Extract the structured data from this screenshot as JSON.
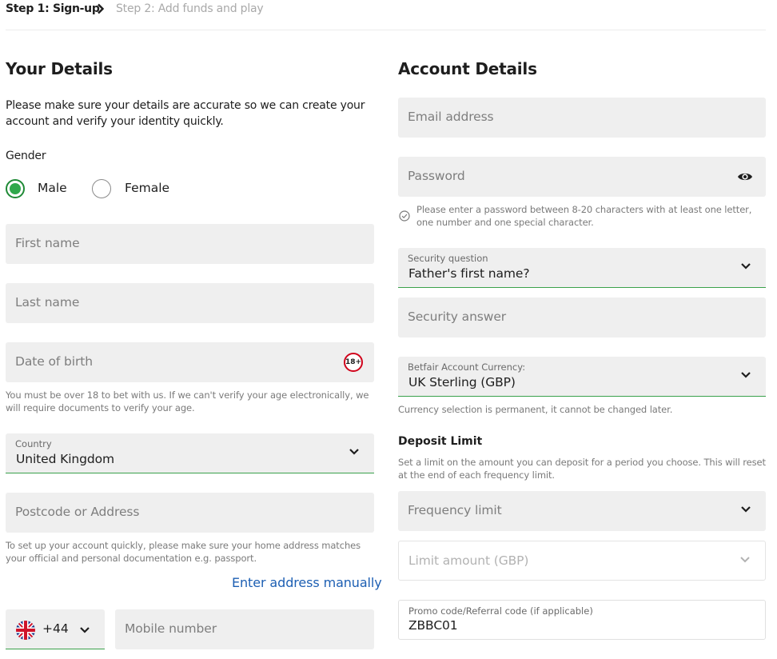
{
  "steps": {
    "step1": "Step 1: Sign-up",
    "step2": "Step 2: Add funds and play"
  },
  "your_details": {
    "heading": "Your Details",
    "intro": "Please make sure your details are accurate so we can create your account and verify your identity quickly.",
    "gender_label": "Gender",
    "gender_options": [
      {
        "label": "Male",
        "selected": true
      },
      {
        "label": "Female",
        "selected": false
      }
    ],
    "first_name_placeholder": "First name",
    "last_name_placeholder": "Last name",
    "dob_placeholder": "Date of birth",
    "age_badge": "18+",
    "age_note": "You must be over 18 to bet with us. If we can't verify your age electronically, we will require documents to verify your age.",
    "country_label": "Country",
    "country_value": "United Kingdom",
    "postcode_placeholder": "Postcode or Address",
    "address_note": "To set up your account quickly, please make sure your home address matches your official and personal documentation e.g. passport.",
    "enter_address_link": "Enter address manually",
    "phone_code": "+44",
    "mobile_placeholder": "Mobile number"
  },
  "account_details": {
    "heading": "Account Details",
    "email_placeholder": "Email address",
    "password_placeholder": "Password",
    "password_hint": "Please enter a password between 8-20 characters with at least one letter, one number and one special character.",
    "security_question_label": "Security question",
    "security_question_value": "Father's first name?",
    "security_answer_placeholder": "Security answer",
    "currency_label": "Betfair Account Currency:",
    "currency_value": "UK Sterling (GBP)",
    "currency_note": "Currency selection is permanent, it cannot be changed later.",
    "deposit_heading": "Deposit Limit",
    "deposit_note": "Set a limit on the amount you can deposit for a period you choose.  This will reset at the end of each frequency limit.",
    "frequency_placeholder": "Frequency limit",
    "limit_amount_placeholder": "Limit amount (GBP)",
    "promo_label": "Promo code/Referral code (if applicable)",
    "promo_value": "ZBBC01"
  },
  "colors": {
    "accent_green": "#2fa84b",
    "link_blue": "#1d5fb3",
    "field_bg": "#efefef",
    "age_badge_red": "#d0021b"
  }
}
